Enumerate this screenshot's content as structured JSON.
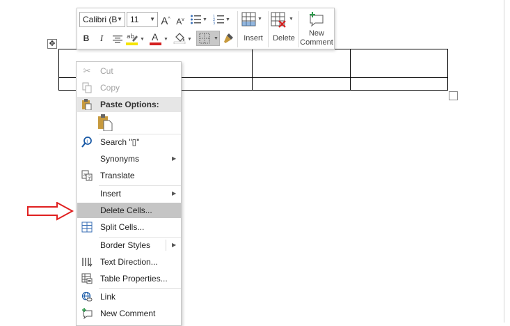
{
  "mini_toolbar": {
    "font_name": "Calibri (B",
    "font_size": "11",
    "grow_font": "A",
    "shrink_font": "A",
    "bold": "B",
    "italic": "I",
    "font_color_letter": "A",
    "insert_label": "Insert",
    "delete_label": "Delete",
    "new_comment_line1": "New",
    "new_comment_line2": "Comment",
    "accent_yellow": "#f5e400",
    "accent_red": "#d42020"
  },
  "context_menu": {
    "cut": "Cut",
    "copy": "Copy",
    "paste_options": "Paste Options:",
    "search": "Search \"▯\"",
    "synonyms": "Synonyms",
    "translate": "Translate",
    "insert": "Insert",
    "delete_cells": "Delete Cells...",
    "split_cells": "Split Cells...",
    "border_styles": "Border Styles",
    "text_direction": "Text Direction...",
    "table_properties": "Table Properties...",
    "link": "Link",
    "new_comment": "New Comment"
  },
  "arrow_color": "#e02020"
}
